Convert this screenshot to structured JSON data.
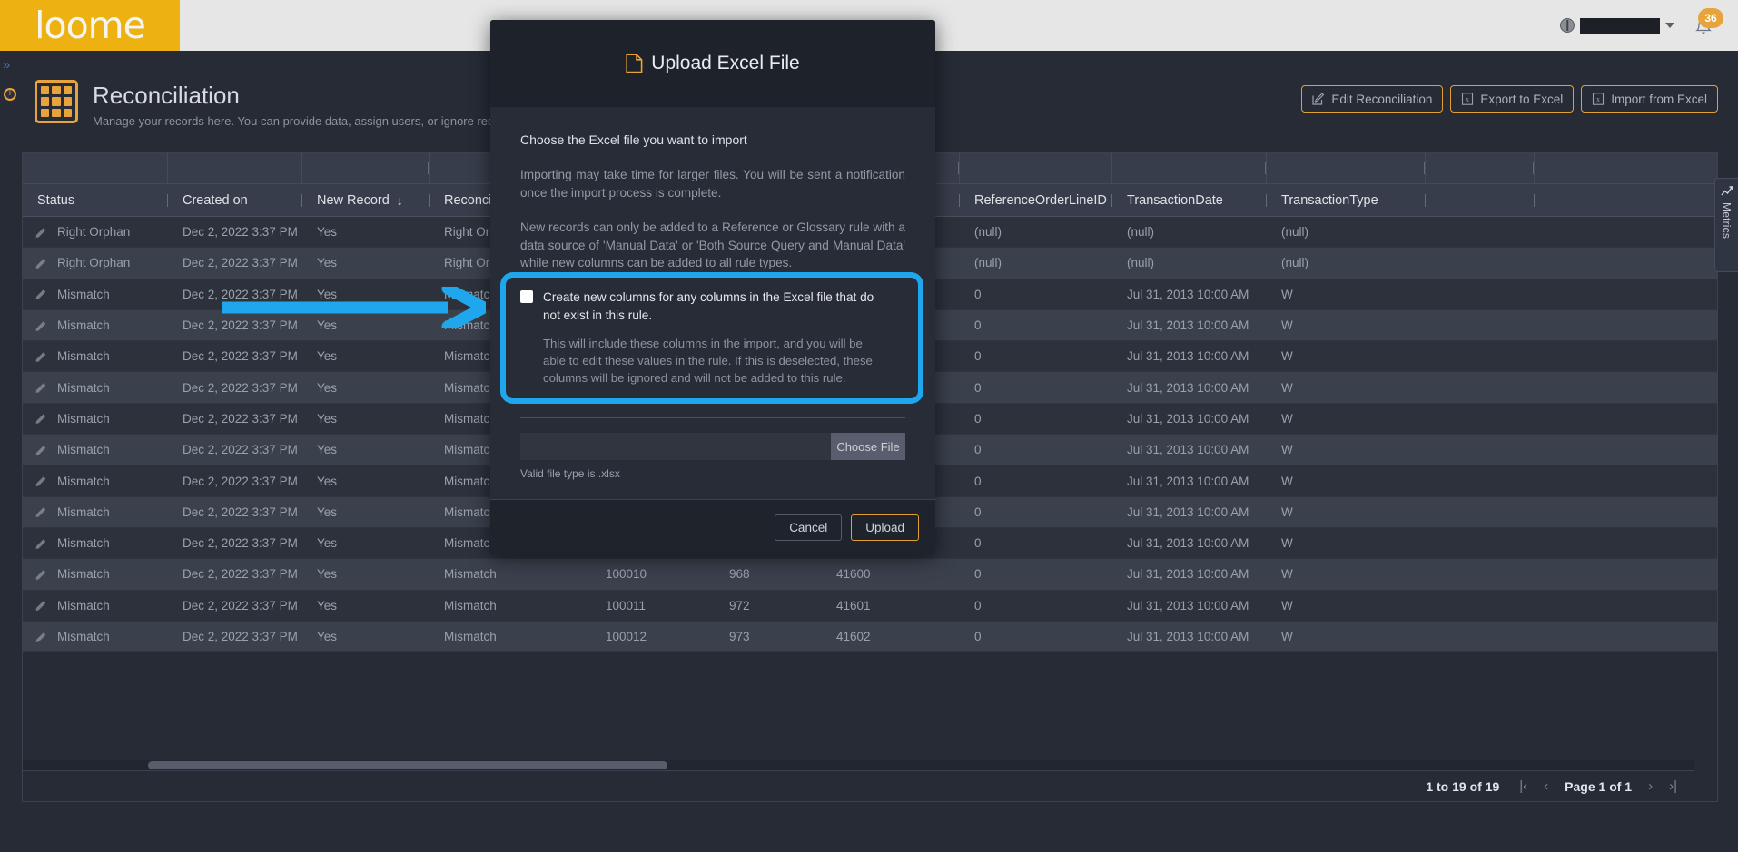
{
  "topbar": {
    "logo_text": "loome",
    "user_name_redacted": "",
    "notification_count": "36",
    "icons": {
      "globe": "globe-icon",
      "caret": "chevron-down-icon",
      "bell": "bell-icon"
    }
  },
  "rail": {
    "expand_glyph": "»",
    "add_glyph": "+"
  },
  "page": {
    "title": "Reconciliation",
    "subtitle": "Manage your records here. You can provide data, assign users, or ignore records.",
    "toolbar": [
      {
        "label": "Edit Reconciliation",
        "icon": "edit-pencil-icon"
      },
      {
        "label": "Export to Excel",
        "icon": "excel-file-icon"
      },
      {
        "label": "Import from Excel",
        "icon": "excel-file-icon"
      }
    ]
  },
  "grid": {
    "columns": [
      {
        "key": "status",
        "label": "Status",
        "sorted": false
      },
      {
        "key": "created_on",
        "label": "Created on",
        "sorted": false
      },
      {
        "key": "new_record",
        "label": "New Record",
        "sorted": true,
        "sort_glyph": "↓"
      },
      {
        "key": "reconciliation",
        "label": "Reconciliation",
        "sorted": false
      },
      {
        "key": "col4",
        "label": "",
        "sorted": false
      },
      {
        "key": "col5",
        "label": "",
        "sorted": false
      },
      {
        "key": "col6",
        "label": "",
        "sorted": false
      },
      {
        "key": "reference_order_line_id",
        "label": "ReferenceOrderLineID",
        "sorted": false
      },
      {
        "key": "transaction_date",
        "label": "TransactionDate",
        "sorted": false
      },
      {
        "key": "transaction_type",
        "label": "TransactionType",
        "sorted": false
      },
      {
        "key": "col10",
        "label": "",
        "sorted": false
      }
    ],
    "rows": [
      {
        "status": "Right Orphan",
        "created_on": "Dec 2, 2022 3:37 PM",
        "new_record": "Yes",
        "reconciliation": "Right Orphan",
        "col4": "",
        "col5": "",
        "col6": "",
        "reference_order_line_id": "(null)",
        "transaction_date": "(null)",
        "transaction_type": "(null)",
        "col10": ""
      },
      {
        "status": "Right Orphan",
        "created_on": "Dec 2, 2022 3:37 PM",
        "new_record": "Yes",
        "reconciliation": "Right Orphan",
        "col4": "",
        "col5": "",
        "col6": "",
        "reference_order_line_id": "(null)",
        "transaction_date": "(null)",
        "transaction_type": "(null)",
        "col10": ""
      },
      {
        "status": "Mismatch",
        "created_on": "Dec 2, 2022 3:37 PM",
        "new_record": "Yes",
        "reconciliation": "Mismatch",
        "col4": "",
        "col5": "",
        "col6": "",
        "reference_order_line_id": "0",
        "transaction_date": "Jul 31, 2013 10:00 AM",
        "transaction_type": "W",
        "col10": ""
      },
      {
        "status": "Mismatch",
        "created_on": "Dec 2, 2022 3:37 PM",
        "new_record": "Yes",
        "reconciliation": "Mismatch",
        "col4": "",
        "col5": "",
        "col6": "",
        "reference_order_line_id": "0",
        "transaction_date": "Jul 31, 2013 10:00 AM",
        "transaction_type": "W",
        "col10": ""
      },
      {
        "status": "Mismatch",
        "created_on": "Dec 2, 2022 3:37 PM",
        "new_record": "Yes",
        "reconciliation": "Mismatch",
        "col4": "",
        "col5": "",
        "col6": "",
        "reference_order_line_id": "0",
        "transaction_date": "Jul 31, 2013 10:00 AM",
        "transaction_type": "W",
        "col10": ""
      },
      {
        "status": "Mismatch",
        "created_on": "Dec 2, 2022 3:37 PM",
        "new_record": "Yes",
        "reconciliation": "Mismatch",
        "col4": "",
        "col5": "",
        "col6": "",
        "reference_order_line_id": "0",
        "transaction_date": "Jul 31, 2013 10:00 AM",
        "transaction_type": "W",
        "col10": ""
      },
      {
        "status": "Mismatch",
        "created_on": "Dec 2, 2022 3:37 PM",
        "new_record": "Yes",
        "reconciliation": "Mismatch",
        "col4": "",
        "col5": "",
        "col6": "",
        "reference_order_line_id": "0",
        "transaction_date": "Jul 31, 2013 10:00 AM",
        "transaction_type": "W",
        "col10": ""
      },
      {
        "status": "Mismatch",
        "created_on": "Dec 2, 2022 3:37 PM",
        "new_record": "Yes",
        "reconciliation": "Mismatch",
        "col4": "",
        "col5": "",
        "col6": "",
        "reference_order_line_id": "0",
        "transaction_date": "Jul 31, 2013 10:00 AM",
        "transaction_type": "W",
        "col10": ""
      },
      {
        "status": "Mismatch",
        "created_on": "Dec 2, 2022 3:37 PM",
        "new_record": "Yes",
        "reconciliation": "Mismatch",
        "col4": "",
        "col5": "",
        "col6": "",
        "reference_order_line_id": "0",
        "transaction_date": "Jul 31, 2013 10:00 AM",
        "transaction_type": "W",
        "col10": ""
      },
      {
        "status": "Mismatch",
        "created_on": "Dec 2, 2022 3:37 PM",
        "new_record": "Yes",
        "reconciliation": "Mismatch",
        "col4": "",
        "col5": "",
        "col6": "",
        "reference_order_line_id": "0",
        "transaction_date": "Jul 31, 2013 10:00 AM",
        "transaction_type": "W",
        "col10": ""
      },
      {
        "status": "Mismatch",
        "created_on": "Dec 2, 2022 3:37 PM",
        "new_record": "Yes",
        "reconciliation": "Mismatch",
        "col4": "",
        "col5": "",
        "col6": "",
        "reference_order_line_id": "0",
        "transaction_date": "Jul 31, 2013 10:00 AM",
        "transaction_type": "W",
        "col10": ""
      },
      {
        "status": "Mismatch",
        "created_on": "Dec 2, 2022 3:37 PM",
        "new_record": "Yes",
        "reconciliation": "Mismatch",
        "col4": "100010",
        "col5": "968",
        "col6": "41600",
        "reference_order_line_id": "0",
        "transaction_date": "Jul 31, 2013 10:00 AM",
        "transaction_type": "W",
        "col10": ""
      },
      {
        "status": "Mismatch",
        "created_on": "Dec 2, 2022 3:37 PM",
        "new_record": "Yes",
        "reconciliation": "Mismatch",
        "col4": "100011",
        "col5": "972",
        "col6": "41601",
        "reference_order_line_id": "0",
        "transaction_date": "Jul 31, 2013 10:00 AM",
        "transaction_type": "W",
        "col10": ""
      },
      {
        "status": "Mismatch",
        "created_on": "Dec 2, 2022 3:37 PM",
        "new_record": "Yes",
        "reconciliation": "Mismatch",
        "col4": "100012",
        "col5": "973",
        "col6": "41602",
        "reference_order_line_id": "0",
        "transaction_date": "Jul 31, 2013 10:00 AM",
        "transaction_type": "W",
        "col10": ""
      }
    ],
    "footer": {
      "range_label": "1 to 19 of 19",
      "page_label": "Page 1 of 1",
      "first_glyph": "|‹",
      "prev_glyph": "‹",
      "next_glyph": "›",
      "last_glyph": "›|"
    },
    "metrics_tab_label": "Metrics"
  },
  "modal": {
    "title": "Upload Excel File",
    "title_icon": "file-icon",
    "lead": "Choose the Excel file you want to import",
    "paragraph_1": "Importing may take time for larger files. You will be sent a notification once the import process is complete.",
    "paragraph_2": "New records can only be added to a Reference or Glossary rule with a data source of 'Manual Data' or 'Both Source Query and Manual Data' while new columns can be added to all rule types.",
    "checkbox_label": "Create new columns for any columns in the Excel file that do not exist in this rule.",
    "checkbox_help": "This will include these columns in the import, and you will be able to edit these values in the rule. If this is deselected, these columns will be ignored and will not be added to this rule.",
    "checkbox_checked": false,
    "file_value": "",
    "choose_file_label": "Choose File",
    "file_hint": "Valid file type is .xlsx",
    "cancel_label": "Cancel",
    "upload_label": "Upload"
  },
  "annotation": {
    "highlight_color": "#1fa7ee",
    "target": "create-new-columns-checkbox"
  },
  "colors": {
    "brand_yellow": "#edb212",
    "accent_orange": "#e0a132",
    "page_bg": "#262b36",
    "row_odd": "#2c313c",
    "row_even": "#3a404c",
    "header_bg": "#373d4a",
    "highlight_blue": "#1fa7ee"
  }
}
